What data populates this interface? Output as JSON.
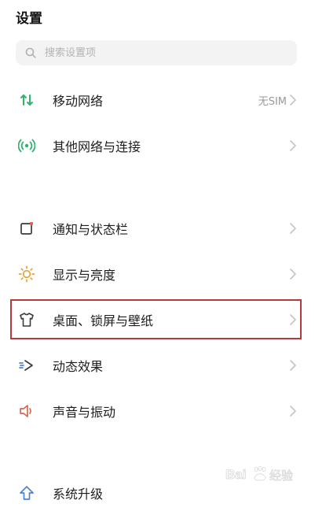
{
  "header": {
    "title": "设置"
  },
  "search": {
    "placeholder": "搜索设置项"
  },
  "items": [
    {
      "label": "移动网络",
      "value": "无SIM",
      "icon": "mobile-data-icon"
    },
    {
      "label": "其他网络与连接",
      "icon": "wireless-icon"
    },
    {
      "label": "通知与状态栏",
      "icon": "notification-icon"
    },
    {
      "label": "显示与亮度",
      "icon": "brightness-icon"
    },
    {
      "label": "桌面、锁屏与壁纸",
      "icon": "tshirt-icon"
    },
    {
      "label": "动态效果",
      "icon": "motion-effect-icon"
    },
    {
      "label": "声音与振动",
      "icon": "speaker-icon"
    },
    {
      "label": "系统升级",
      "icon": "arrow-up-icon"
    }
  ],
  "colors": {
    "icon_green": "#2fb36d",
    "icon_orange": "#e8a23a",
    "icon_red": "#d8654e",
    "icon_blue": "#4c84d6",
    "icon_dark": "#3a3a3a",
    "highlight_border": "#b33b3b"
  }
}
